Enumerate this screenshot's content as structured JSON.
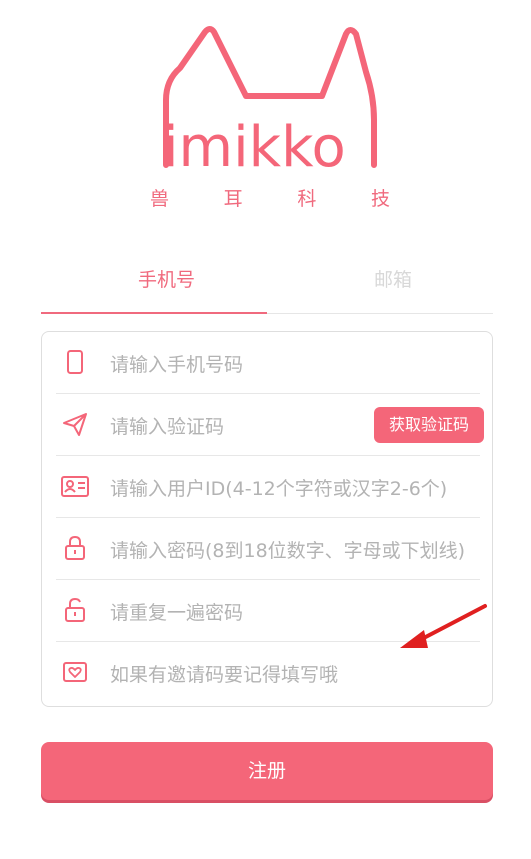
{
  "brand": {
    "logo_text": "imikko",
    "subtitle_chars": [
      "兽",
      "耳",
      "科",
      "技"
    ]
  },
  "tabs": [
    {
      "label": "手机号",
      "active": true
    },
    {
      "label": "邮箱",
      "active": false
    }
  ],
  "form": {
    "fields": [
      {
        "icon": "phone-icon",
        "placeholder": "请输入手机号码"
      },
      {
        "icon": "send-icon",
        "placeholder": "请输入验证码",
        "action_label": "获取验证码"
      },
      {
        "icon": "id-card-icon",
        "placeholder": "请输入用户ID(4-12个字符或汉字2-6个)"
      },
      {
        "icon": "lock-icon",
        "placeholder": "请输入密码(8到18位数字、字母或下划线)"
      },
      {
        "icon": "unlock-icon",
        "placeholder": "请重复一遍密码"
      },
      {
        "icon": "heart-card-icon",
        "placeholder": "如果有邀请码要记得填写哦"
      }
    ]
  },
  "submit_label": "注册",
  "colors": {
    "accent": "#f46679",
    "accent_text": "#f06a7e",
    "placeholder": "#b3b3b3",
    "annotation_arrow": "#e02020"
  }
}
